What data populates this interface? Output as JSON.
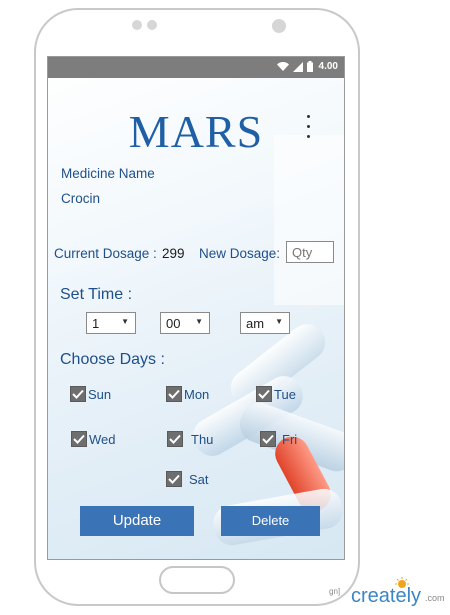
{
  "status_bar": {
    "time": "4.00"
  },
  "app": {
    "title": "MARS",
    "menu_icon": "more-vertical-icon"
  },
  "medicine": {
    "label": "Medicine Name",
    "value": "Crocin"
  },
  "dosage": {
    "current_label": "Current Dosage :",
    "current_value": "299",
    "new_label": "New Dosage:",
    "new_placeholder": "Qty"
  },
  "set_time": {
    "heading": "Set Time :",
    "hour": "1",
    "minute": "00",
    "period": "am"
  },
  "choose_days": {
    "heading": "Choose Days :",
    "days": [
      {
        "label": "Sun",
        "checked": true
      },
      {
        "label": "Mon",
        "checked": true
      },
      {
        "label": "Tue",
        "checked": true
      },
      {
        "label": "Wed",
        "checked": true
      },
      {
        "label": "Thu",
        "checked": true
      },
      {
        "label": "Fri",
        "checked": true
      },
      {
        "label": "Sat",
        "checked": true
      }
    ]
  },
  "actions": {
    "update_label": "Update",
    "delete_label": "Delete"
  },
  "watermark": {
    "brand": "creately",
    "suffix": ".com",
    "fragment": "gn]"
  },
  "colors": {
    "accent": "#1f5fa6",
    "button": "#3a73b6",
    "status_bar": "#7d7d7d"
  }
}
